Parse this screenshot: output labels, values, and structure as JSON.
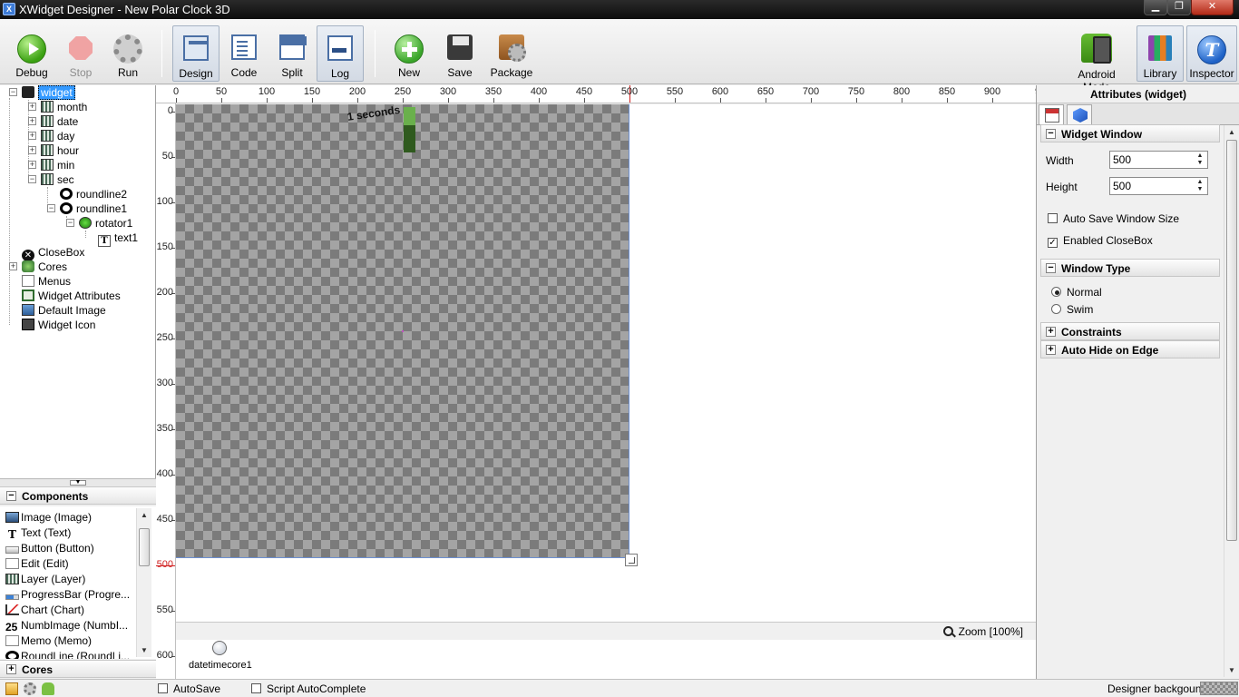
{
  "window": {
    "title": "XWidget Designer - New Polar Clock 3D",
    "app_icon_text": "X",
    "minimize_glyph": "▁",
    "maximize_glyph": "❐",
    "close_glyph": "✕"
  },
  "toolbar": {
    "debug": "Debug",
    "stop": "Stop",
    "run": "Run",
    "design": "Design",
    "code": "Code",
    "split": "Split",
    "log": "Log",
    "new": "New",
    "save": "Save",
    "package": "Package",
    "android_mode": "Android Mode",
    "library": "Library",
    "inspector": "Inspector"
  },
  "tree": {
    "widget": "widget",
    "month": "month",
    "date": "date",
    "day": "day",
    "hour": "hour",
    "min": "min",
    "sec": "sec",
    "roundline2": "roundline2",
    "roundline1": "roundline1",
    "rotator1": "rotator1",
    "text1": "text1",
    "closebox": "CloseBox",
    "cores": "Cores",
    "menus": "Menus",
    "widget_attributes": "Widget Attributes",
    "default_image": "Default Image",
    "widget_icon": "Widget Icon"
  },
  "components": {
    "header": "Components",
    "items": [
      "Image (Image)",
      "Text (Text)",
      "Button (Button)",
      "Edit (Edit)",
      "Layer (Layer)",
      "ProgressBar (Progre...",
      "Chart (Chart)",
      "NumbImage (NumbI...",
      "Memo (Memo)",
      "RoundLine (RoundLi..."
    ],
    "numb_icon_text": "25"
  },
  "cores_panel": {
    "header": "Cores"
  },
  "ruler": {
    "h_labels": [
      "0",
      "50",
      "100",
      "150",
      "200",
      "250",
      "300",
      "350",
      "400",
      "450",
      "500",
      "550",
      "600",
      "650",
      "700",
      "750",
      "800",
      "850",
      "900",
      "9"
    ],
    "v_labels": [
      "0",
      "50",
      "100",
      "150",
      "200",
      "250",
      "300",
      "350",
      "400",
      "450",
      "500",
      "550",
      "600"
    ],
    "marker_value": "500"
  },
  "canvas": {
    "seconds_text": "1 seconds",
    "zoom": "Zoom [100%]",
    "core_item": "datetimecore1"
  },
  "attributes": {
    "title": "Attributes (widget)",
    "widget_window": "Widget Window",
    "width_label": "Width",
    "width_value": "500",
    "height_label": "Height",
    "height_value": "500",
    "auto_save_window_size": "Auto Save Window Size",
    "enabled_closebox": "Enabled CloseBox",
    "window_type": "Window Type",
    "normal": "Normal",
    "swim": "Swim",
    "constraints": "Constraints",
    "auto_hide_on_edge": "Auto Hide on Edge"
  },
  "statusbar": {
    "autosave": "AutoSave",
    "script_autocomplete": "Script AutoComplete",
    "designer_background": "Designer backgound"
  },
  "glyphs": {
    "plus": "+",
    "minus": "−",
    "check": "✓",
    "close_x": "✕",
    "text_t": "T",
    "arrow_up": "▲",
    "arrow_down": "▼",
    "grip": "▼"
  }
}
